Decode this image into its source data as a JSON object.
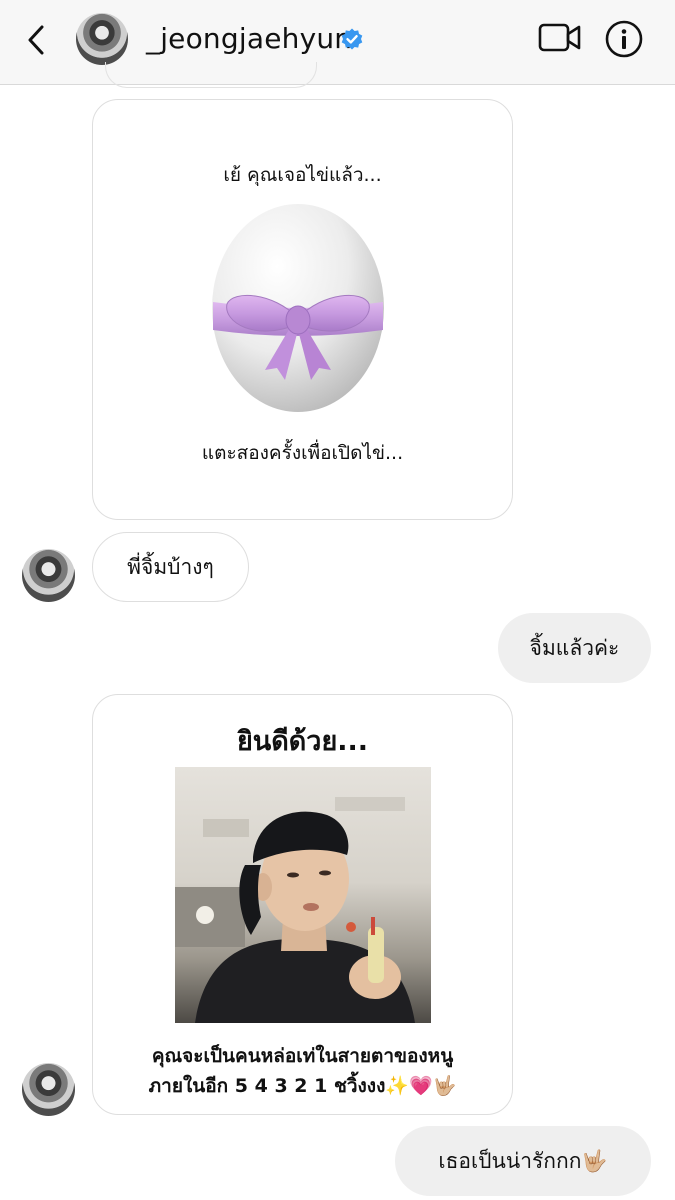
{
  "header": {
    "username": "_jeongjaehyun",
    "verified": true,
    "icons": [
      "back-chevron-icon",
      "profile-avatar",
      "verified-badge-icon",
      "video-call-icon",
      "info-icon"
    ]
  },
  "messages": [
    {
      "type": "card",
      "sender": "other",
      "top_text": "เย้ คุณเจอไข่แล้ว...",
      "image": "white egg with pink ribbon bow",
      "bottom_text": "แตะสองครั้งเพื่อเปิดไข่..."
    },
    {
      "type": "text",
      "sender": "other",
      "text": "พี่จิ้มบ้างๆ"
    },
    {
      "type": "text",
      "sender": "me",
      "text": "จิ้มแล้วค่ะ"
    },
    {
      "type": "card",
      "sender": "other",
      "title": "ยินดีด้วย...",
      "image": "photo of young man in black cap and t-shirt",
      "caption_line1": "คุณจะเป็นคนหล่อเท่ในสายตาของหนู",
      "caption_line2": "ภายในอีก 5 4 3 2 1 ชวิ้งงง✨💗🤟🏼"
    },
    {
      "type": "text",
      "sender": "me",
      "text": "เธอเป็นน่ารักกก🤟🏼"
    }
  ],
  "colors": {
    "header_bg": "#f7f7f7",
    "verified_blue": "#3897f0",
    "incoming_border": "#dedede",
    "outgoing_bubble": "#efefef",
    "ribbon_pink": "#c99be0"
  }
}
